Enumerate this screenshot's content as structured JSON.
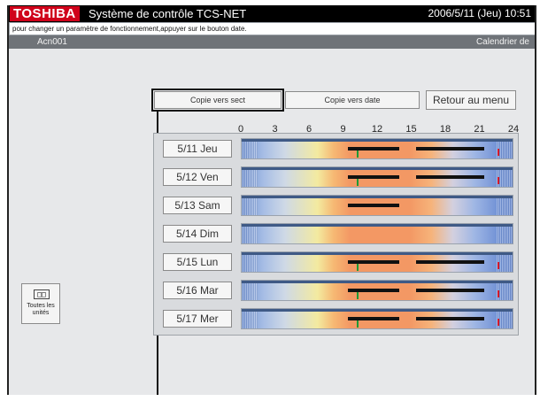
{
  "header": {
    "brand": "TOSHIBA",
    "title": "Système de contrôle TCS-NET",
    "datetime": "2006/5/11 (Jeu) 10:51"
  },
  "info_message": "pour changer un paramètre de fonctionnement,appuyer sur le bouton date.",
  "unit_bar": {
    "unit_name": "Acn001",
    "screen_name": "Calendrier de"
  },
  "toolbar": {
    "copy_sect_label": "Copie vers sect",
    "copy_date_label": "Copie vers date",
    "menu_label": "Retour au menu"
  },
  "hour_ticks": [
    "0",
    "3",
    "6",
    "9",
    "12",
    "15",
    "18",
    "21",
    "24"
  ],
  "days": [
    {
      "label": "5/11 Jeu",
      "bars": [
        [
          12.5,
          18.5
        ],
        [
          20.5,
          28.5
        ]
      ],
      "green": 13.5,
      "red": 30.0
    },
    {
      "label": "5/12 Ven",
      "bars": [
        [
          12.5,
          18.5
        ],
        [
          20.5,
          28.5
        ]
      ],
      "green": 13.5,
      "red": 30.0
    },
    {
      "label": "5/13 Sam",
      "bars": [
        [
          12.5,
          18.5
        ]
      ],
      "green": null,
      "red": null
    },
    {
      "label": "5/14 Dim",
      "bars": [],
      "green": null,
      "red": null
    },
    {
      "label": "5/15 Lun",
      "bars": [
        [
          12.5,
          18.5
        ],
        [
          20.5,
          28.5
        ]
      ],
      "green": 13.5,
      "red": 30.0
    },
    {
      "label": "5/16 Mar",
      "bars": [
        [
          12.5,
          18.5
        ],
        [
          20.5,
          28.5
        ]
      ],
      "green": 13.5,
      "red": 30.0
    },
    {
      "label": "5/17 Mer",
      "bars": [
        [
          12.5,
          18.5
        ],
        [
          20.5,
          28.5
        ]
      ],
      "green": 13.5,
      "red": 30.0
    }
  ],
  "all_units_button": {
    "icon": "unit-group-icon",
    "label": "Toutes les unités"
  }
}
